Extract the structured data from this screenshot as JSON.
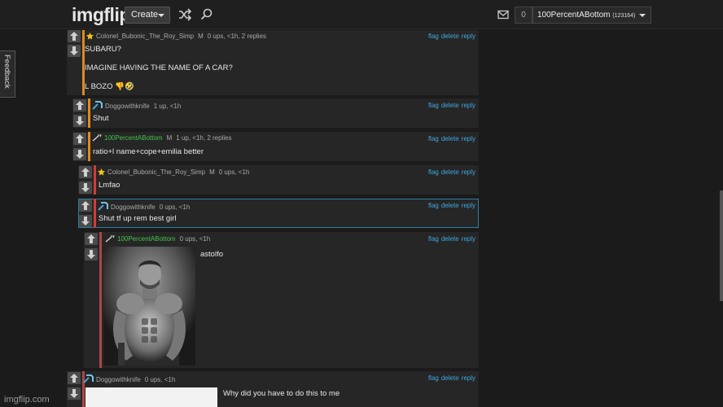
{
  "header": {
    "logo_img": "img",
    "logo_flip": "flip",
    "create_label": "Create",
    "notification_count": "0",
    "username": "100PercentABottom",
    "user_points": "(123164)"
  },
  "feedback_label": "Feedback",
  "actions": {
    "flag": "flag",
    "delete": "delete",
    "reply": "reply"
  },
  "comments": [
    {
      "username": "Colonel_Bubonic_The_Roy_Simp",
      "mod": "M",
      "stats": "0 ups, <1h, 2 replies",
      "lines": [
        "SUBARU?",
        "IMAGINE HAVING THE NAME OF A CAR?",
        "L BOZO 👎🤣"
      ],
      "bar_color": "#e08a1e"
    },
    {
      "username": "Doggowithknife",
      "stats": "1 up, <1h",
      "lines": [
        "Shut"
      ],
      "bar_color": "#e08a1e"
    },
    {
      "username": "100PercentABottom",
      "mod": "M",
      "stats": "1 up, <1h, 2 replies",
      "lines": [
        "ratio+l name+cope+emilia better"
      ],
      "bar_color": "#e08a1e"
    },
    {
      "username": "Colonel_Bubonic_The_Roy_Simp",
      "mod": "M",
      "stats": "0 ups, <1h",
      "lines": [
        "Lmfao"
      ],
      "bar_color": "#d33b3b"
    },
    {
      "username": "Doggowithknife",
      "stats": "0 ups, <1h",
      "lines": [
        "Shut tf up rem best girl"
      ],
      "bar_color": "#d33b3b"
    },
    {
      "username": "100PercentABottom",
      "stats": "0 ups, <1h",
      "lines": [
        "astolfo"
      ],
      "bar_color": "#b04545"
    },
    {
      "username": "Doggowithknife",
      "stats": "0 ups, <1h",
      "lines": [
        "Why did you have to do this to me"
      ],
      "bar_color": "#b04545"
    }
  ],
  "watermark": "imgflip.com",
  "colors": {
    "background": "#1b1b1b",
    "comment_bg": "#262626",
    "link_blue": "#3da8e0",
    "username_green": "#43c548",
    "bar_orange": "#e08a1e",
    "bar_red": "#d33b3b"
  },
  "icons": [
    "shuffle-icon",
    "search-icon",
    "mail-icon",
    "star-icon",
    "pickaxe-icon",
    "sword-icon",
    "upvote-icon",
    "downvote-icon"
  ]
}
